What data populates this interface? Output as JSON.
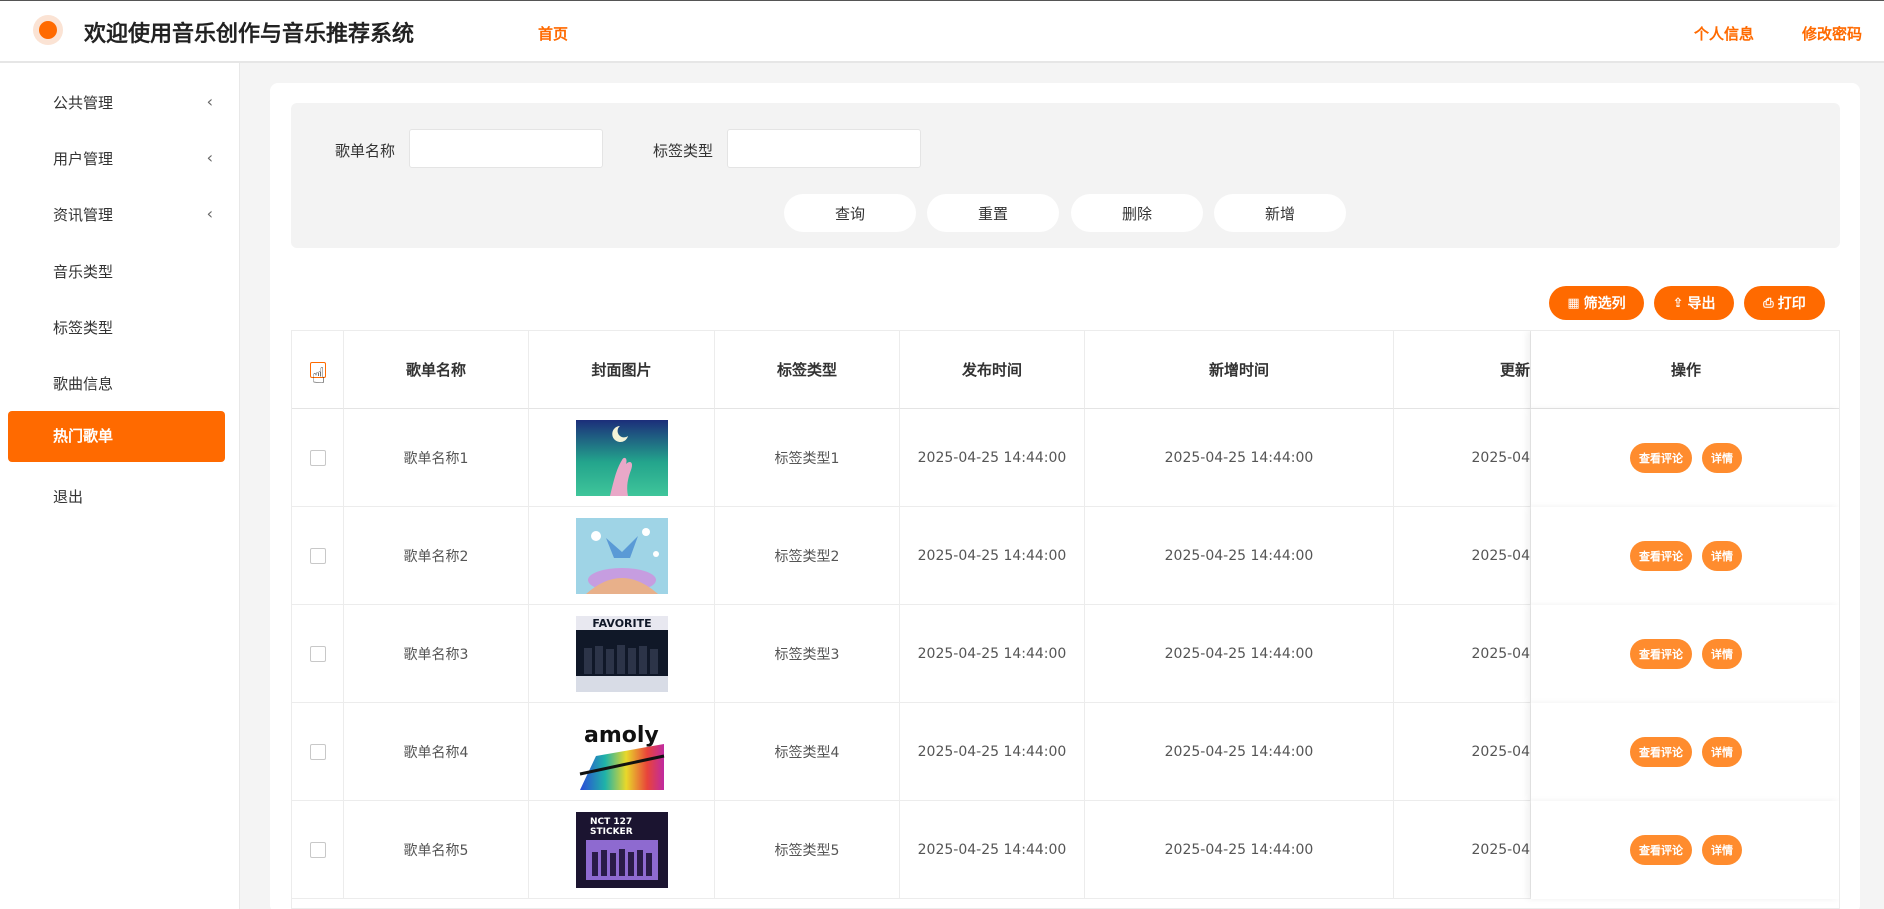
{
  "header": {
    "app_title": "欢迎使用音乐创作与音乐推荐系统",
    "nav_home": "首页",
    "nav_profile": "个人信息",
    "nav_change_password": "修改密码",
    "accent_color": "#ff6a00"
  },
  "sidebar": {
    "items": [
      {
        "label": "公共管理",
        "has_arrow": true
      },
      {
        "label": "用户管理",
        "has_arrow": true
      },
      {
        "label": "资讯管理",
        "has_arrow": true
      },
      {
        "label": "音乐类型",
        "has_arrow": false
      },
      {
        "label": "标签类型",
        "has_arrow": false
      },
      {
        "label": "歌曲信息",
        "has_arrow": false
      },
      {
        "label": "热门歌单",
        "has_arrow": false,
        "active": true
      },
      {
        "label": "退出",
        "has_arrow": false
      }
    ],
    "arrow_glyph": "‹"
  },
  "search": {
    "playlist_name_label": "歌单名称",
    "playlist_name_value": "",
    "tag_type_label": "标签类型",
    "tag_type_value": "",
    "query_label": "查询",
    "reset_label": "重置",
    "delete_label": "删除",
    "add_label": "新增"
  },
  "toolbar": {
    "filter_columns_label": "筛选列",
    "export_label": "导出",
    "print_label": "打印"
  },
  "table": {
    "headers": {
      "name": "歌单名称",
      "cover": "封面图片",
      "tag": "标签类型",
      "publish_time": "发布时间",
      "add_time": "新增时间",
      "update_time": "更新",
      "actions": "操作"
    },
    "rows": [
      {
        "name": "歌单名称1",
        "tag": "标签类型1",
        "publish_time": "2025-04-25 14:44:00",
        "add_time": "2025-04-25 14:44:00",
        "update_time": "2025-04",
        "cover": "cover-hand-moon"
      },
      {
        "name": "歌单名称2",
        "tag": "标签类型2",
        "publish_time": "2025-04-25 14:44:00",
        "add_time": "2025-04-25 14:44:00",
        "update_time": "2025-04",
        "cover": "cover-anime-sky"
      },
      {
        "name": "歌单名称3",
        "tag": "标签类型3",
        "publish_time": "2025-04-25 14:44:00",
        "add_time": "2025-04-25 14:44:00",
        "update_time": "2025-04",
        "cover": "cover-group-dark"
      },
      {
        "name": "歌单名称4",
        "tag": "标签类型4",
        "publish_time": "2025-04-25 14:44:00",
        "add_time": "2025-04-25 14:44:00",
        "update_time": "2025-04",
        "cover": "cover-rainbow-text"
      },
      {
        "name": "歌单名称5",
        "tag": "标签类型5",
        "publish_time": "2025-04-25 14:44:00",
        "add_time": "2025-04-25 14:44:00",
        "update_time": "2025-04",
        "cover": "cover-sticker-purple"
      }
    ],
    "view_comments_label": "查看评论",
    "detail_label": "详情"
  }
}
